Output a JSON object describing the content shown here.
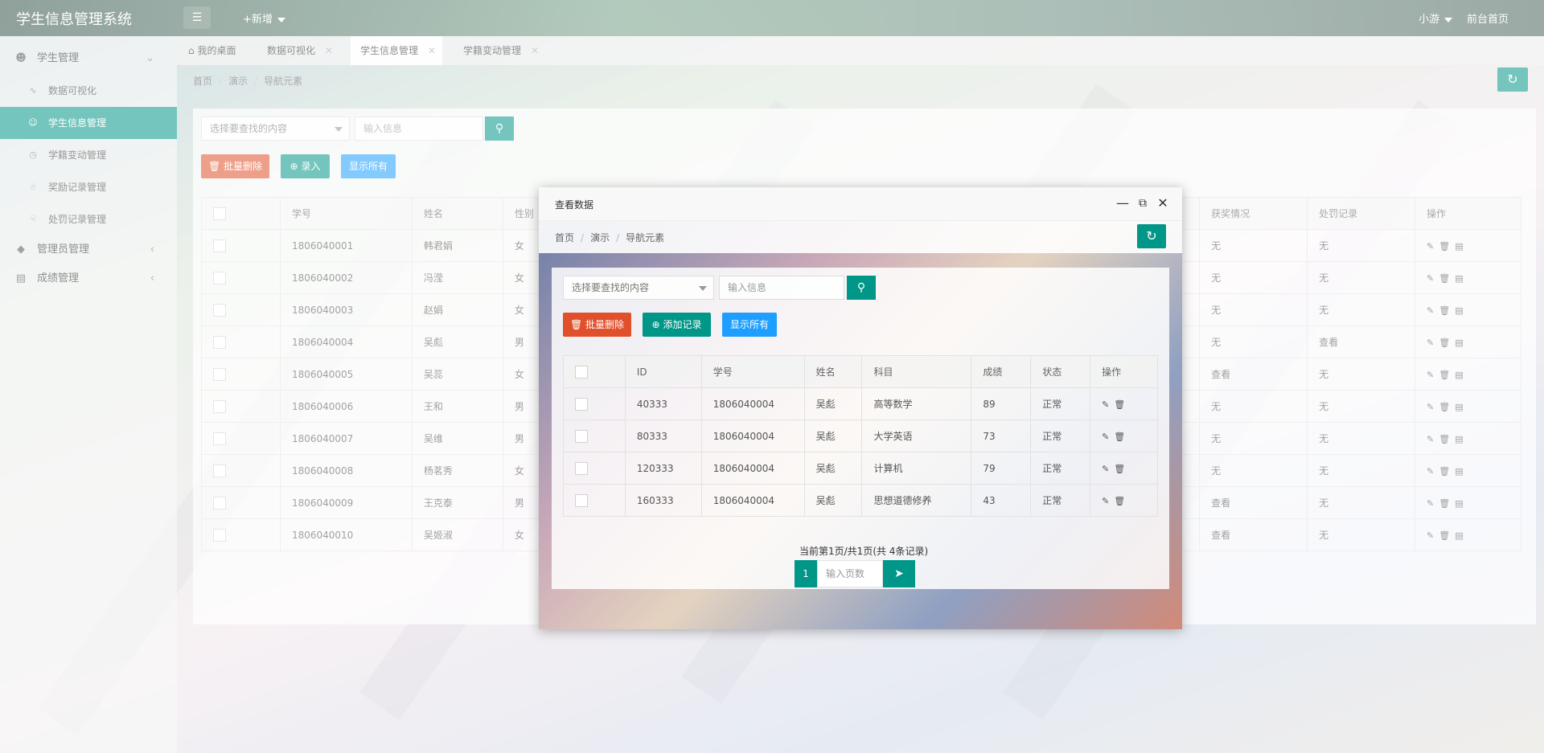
{
  "app": {
    "title": "学生信息管理系统"
  },
  "header": {
    "add_label": "+新增",
    "user_label": "小游",
    "front_label": "前台首页"
  },
  "sidebar": {
    "groups": [
      {
        "label": "学生管理",
        "icon": "user-icon",
        "expanded": true
      },
      {
        "label": "管理员管理",
        "icon": "diamond-icon"
      },
      {
        "label": "成绩管理",
        "icon": "report-icon"
      }
    ],
    "items": [
      {
        "label": "数据可视化",
        "icon": "pulse-icon"
      },
      {
        "label": "学生信息管理",
        "icon": "user-icon",
        "active": true
      },
      {
        "label": "学籍变动管理",
        "icon": "clock-icon"
      },
      {
        "label": "奖励记录管理",
        "icon": "thumb-up-icon"
      },
      {
        "label": "处罚记录管理",
        "icon": "thumb-down-icon"
      }
    ]
  },
  "tabs": [
    {
      "label": "我的桌面",
      "icon": "home-icon"
    },
    {
      "label": "数据可视化"
    },
    {
      "label": "学生信息管理",
      "active": true
    },
    {
      "label": "学籍变动管理"
    }
  ],
  "breadcrumb": [
    "首页",
    "演示",
    "导航元素"
  ],
  "main": {
    "search_select_placeholder": "选择要查找的内容",
    "search_input_placeholder": "输入信息",
    "batch_delete_label": "批量删除",
    "add_label": "录入",
    "show_all_label": "显示所有",
    "columns": [
      "学号",
      "姓名",
      "性别",
      "获奖情况",
      "处罚记录",
      "操作"
    ],
    "rows": [
      {
        "id": "1806040001",
        "name": "韩君娟",
        "gender": "女",
        "award": "无",
        "penalty": "无"
      },
      {
        "id": "1806040002",
        "name": "冯滢",
        "gender": "女",
        "award": "无",
        "penalty": "无"
      },
      {
        "id": "1806040003",
        "name": "赵娟",
        "gender": "女",
        "award": "无",
        "penalty": "无"
      },
      {
        "id": "1806040004",
        "name": "吴彪",
        "gender": "男",
        "award": "无",
        "penalty": "查看"
      },
      {
        "id": "1806040005",
        "name": "吴蕊",
        "gender": "女",
        "award": "查看",
        "penalty": "无"
      },
      {
        "id": "1806040006",
        "name": "王和",
        "gender": "男",
        "award": "无",
        "penalty": "无"
      },
      {
        "id": "1806040007",
        "name": "吴维",
        "gender": "男",
        "award": "无",
        "penalty": "无"
      },
      {
        "id": "1806040008",
        "name": "杨茗秀",
        "gender": "女",
        "award": "无",
        "penalty": "无"
      },
      {
        "id": "1806040009",
        "name": "王克泰",
        "gender": "男",
        "award": "查看",
        "penalty": "无"
      },
      {
        "id": "1806040010",
        "name": "吴姬淑",
        "gender": "女",
        "award": "查看",
        "penalty": "无"
      }
    ]
  },
  "modal": {
    "title": "查看数据",
    "breadcrumb": [
      "首页",
      "演示",
      "导航元素"
    ],
    "search_select_placeholder": "选择要查找的内容",
    "search_input_placeholder": "输入信息",
    "batch_delete_label": "批量删除",
    "add_label": "添加记录",
    "show_all_label": "显示所有",
    "columns": [
      "ID",
      "学号",
      "姓名",
      "科目",
      "成绩",
      "状态",
      "操作"
    ],
    "rows": [
      {
        "id": "40333",
        "sno": "1806040004",
        "name": "吴彪",
        "subject": "高等数学",
        "score": "89",
        "status": "正常"
      },
      {
        "id": "80333",
        "sno": "1806040004",
        "name": "吴彪",
        "subject": "大学英语",
        "score": "73",
        "status": "正常"
      },
      {
        "id": "120333",
        "sno": "1806040004",
        "name": "吴彪",
        "subject": "计算机",
        "score": "79",
        "status": "正常"
      },
      {
        "id": "160333",
        "sno": "1806040004",
        "name": "吴彪",
        "subject": "思想道德修养",
        "score": "43",
        "status": "正常"
      }
    ],
    "pager_info": "当前第1页/共1页(共 4条记录)",
    "current_page": "1",
    "page_input_placeholder": "输入页数"
  },
  "colors": {
    "accent": "#009688",
    "danger": "#e0502a",
    "info": "#1e9fff"
  }
}
